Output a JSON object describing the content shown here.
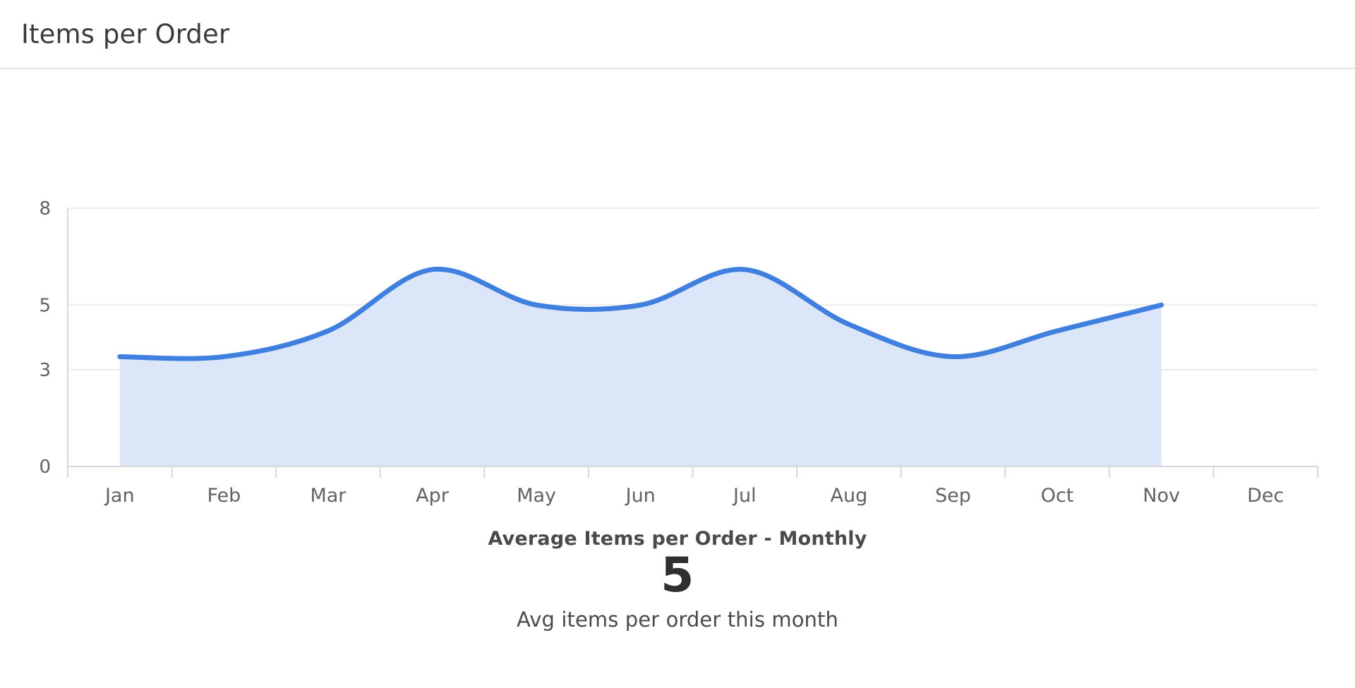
{
  "panel": {
    "title": "Items per Order"
  },
  "chart_data": {
    "type": "area",
    "title": "Average Items per Order - Monthly",
    "xlabel": "",
    "ylabel": "",
    "categories": [
      "Jan",
      "Feb",
      "Mar",
      "Apr",
      "May",
      "Jun",
      "Jul",
      "Aug",
      "Sep",
      "Oct",
      "Nov",
      "Dec"
    ],
    "values": [
      3.4,
      3.4,
      4.2,
      6.1,
      5.0,
      5.0,
      6.1,
      4.4,
      3.4,
      4.2,
      5.0,
      null
    ],
    "series": [
      {
        "name": "Average Items per Order",
        "values": [
          3.4,
          3.4,
          4.2,
          6.1,
          5.0,
          5.0,
          6.1,
          4.4,
          3.4,
          4.2,
          5.0,
          null
        ]
      }
    ],
    "y_ticks": [
      0,
      3,
      5,
      8
    ],
    "y_tick_labels": [
      "0",
      "3",
      "5",
      "8"
    ],
    "ylim": [
      0,
      8
    ],
    "grid": true,
    "legend": false,
    "curve": "smooth",
    "line_color": "#3f7fe0",
    "fill_color": "#dbe6f8",
    "grid_color": "#ebebeb",
    "axis_color": "#d8d8d8"
  },
  "kpi": {
    "value": "5",
    "label": "Avg items per order this month"
  }
}
